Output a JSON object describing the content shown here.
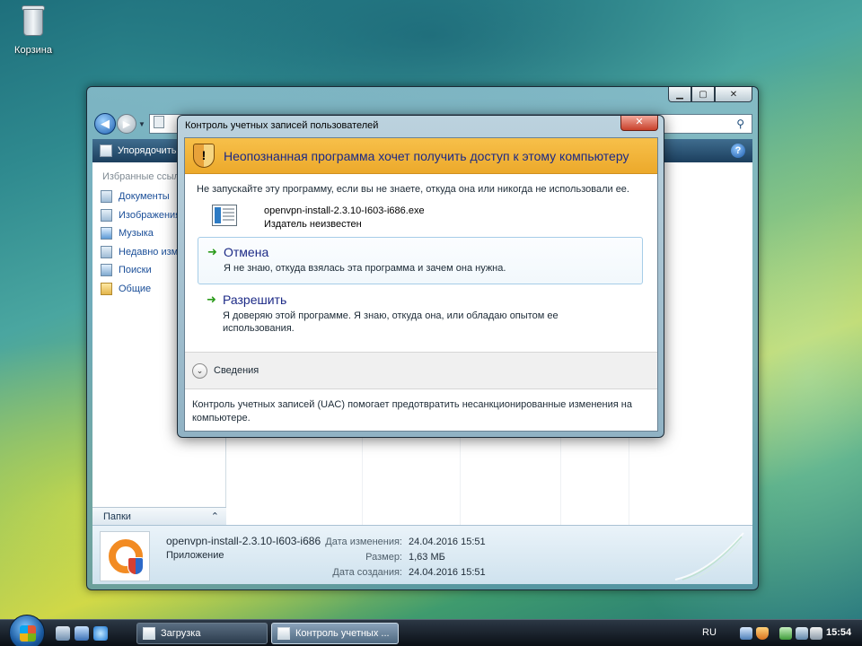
{
  "desktop": {
    "recycle_bin_label": "Корзина"
  },
  "explorer": {
    "toolbar": {
      "organize_label": "Упорядочить"
    },
    "nav_pane": {
      "favorites_header": "Избранные ссылки",
      "items": [
        {
          "label": "Документы",
          "icon": "documents-icon"
        },
        {
          "label": "Изображения",
          "icon": "pictures-icon"
        },
        {
          "label": "Музыка",
          "icon": "music-icon"
        },
        {
          "label": "Недавно измененные",
          "icon": "recent-icon"
        },
        {
          "label": "Поиски",
          "icon": "searches-icon"
        },
        {
          "label": "Общие",
          "icon": "public-folder-icon"
        }
      ],
      "folders_label": "Папки"
    },
    "details_pane": {
      "file_name": "openvpn-install-2.3.10-I603-i686",
      "file_type": "Приложение",
      "labels": {
        "modified": "Дата изменения:",
        "size": "Размер:",
        "created": "Дата создания:"
      },
      "values": {
        "modified": "24.04.2016 15:51",
        "size": "1,63 МБ",
        "created": "24.04.2016 15:51"
      }
    }
  },
  "uac": {
    "title": "Контроль учетных записей пользователей",
    "banner": "Неопознанная программа хочет получить доступ к этому компьютеру",
    "warning": "Не запускайте эту программу, если вы не знаете, откуда она или никогда не использовали ее.",
    "program_name": "openvpn-install-2.3.10-I603-i686.exe",
    "publisher": "Издатель неизвестен",
    "cancel_option": {
      "title": "Отмена",
      "description": "Я не знаю, откуда взялась эта программа и зачем она нужна."
    },
    "allow_option": {
      "title": "Разрешить",
      "description": "Я доверяю этой программе. Я знаю, откуда она, или обладаю опытом ее использования."
    },
    "details_label": "Сведения",
    "footer": "Контроль учетных записей (UAC) помогает предотвратить несанкционированные изменения на компьютере."
  },
  "taskbar": {
    "tasks": [
      {
        "label": "Загрузка"
      },
      {
        "label": "Контроль учетных ..."
      }
    ],
    "language": "RU",
    "clock": "15:54"
  },
  "colors": {
    "uac_banner": "#f2b53a",
    "link_blue": "#1a4e98",
    "option_arrow": "#2c9b1c"
  }
}
